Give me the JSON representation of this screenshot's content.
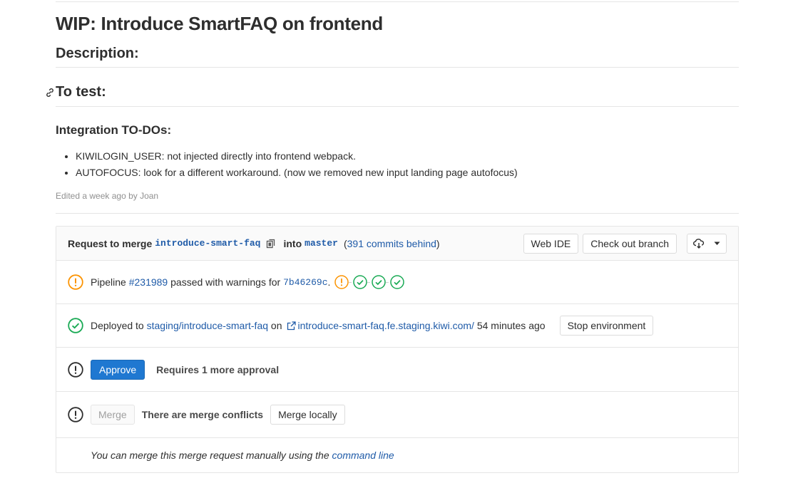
{
  "title": "WIP: Introduce SmartFAQ on frontend",
  "description_heading": "Description:",
  "to_test_heading": "To test:",
  "todo_heading": "Integration TO-DOs:",
  "todo_items": [
    "KIWILOGIN_USER: not injected directly into frontend webpack.",
    "AUTOFOCUS: look for a different workaround. (now we removed new input landing page autofocus)"
  ],
  "edited_note": "Edited a week ago by Joan",
  "mr_header": {
    "request_label": "Request to merge",
    "source_branch": "introduce-smart-faq",
    "into_label": "into",
    "target_branch": "master",
    "behind_open": "(",
    "behind_link": "391 commits behind",
    "behind_close": ")",
    "web_ide_label": "Web IDE",
    "checkout_label": "Check out branch"
  },
  "pipeline": {
    "prefix": "Pipeline",
    "id": "#231989",
    "status_text": "passed with warnings for",
    "commit": "7b46269c",
    "suffix": "."
  },
  "deploy": {
    "prefix": "Deployed to",
    "env": "staging/introduce-smart-faq",
    "on": "on",
    "url": "introduce-smart-faq.fe.staging.kiwi.com/",
    "time": "54 minutes ago",
    "stop_label": "Stop environment"
  },
  "approval": {
    "approve_label": "Approve",
    "requires_text": "Requires 1 more approval"
  },
  "merge": {
    "merge_label": "Merge",
    "conflicts_text": "There are merge conflicts",
    "merge_locally_label": "Merge locally"
  },
  "manual": {
    "text": "You can merge this merge request manually using the",
    "link": "command line"
  },
  "colors": {
    "link": "#1f5ba8",
    "warning": "#fc9403",
    "success": "#1aaa55",
    "primary": "#1f78d1"
  }
}
